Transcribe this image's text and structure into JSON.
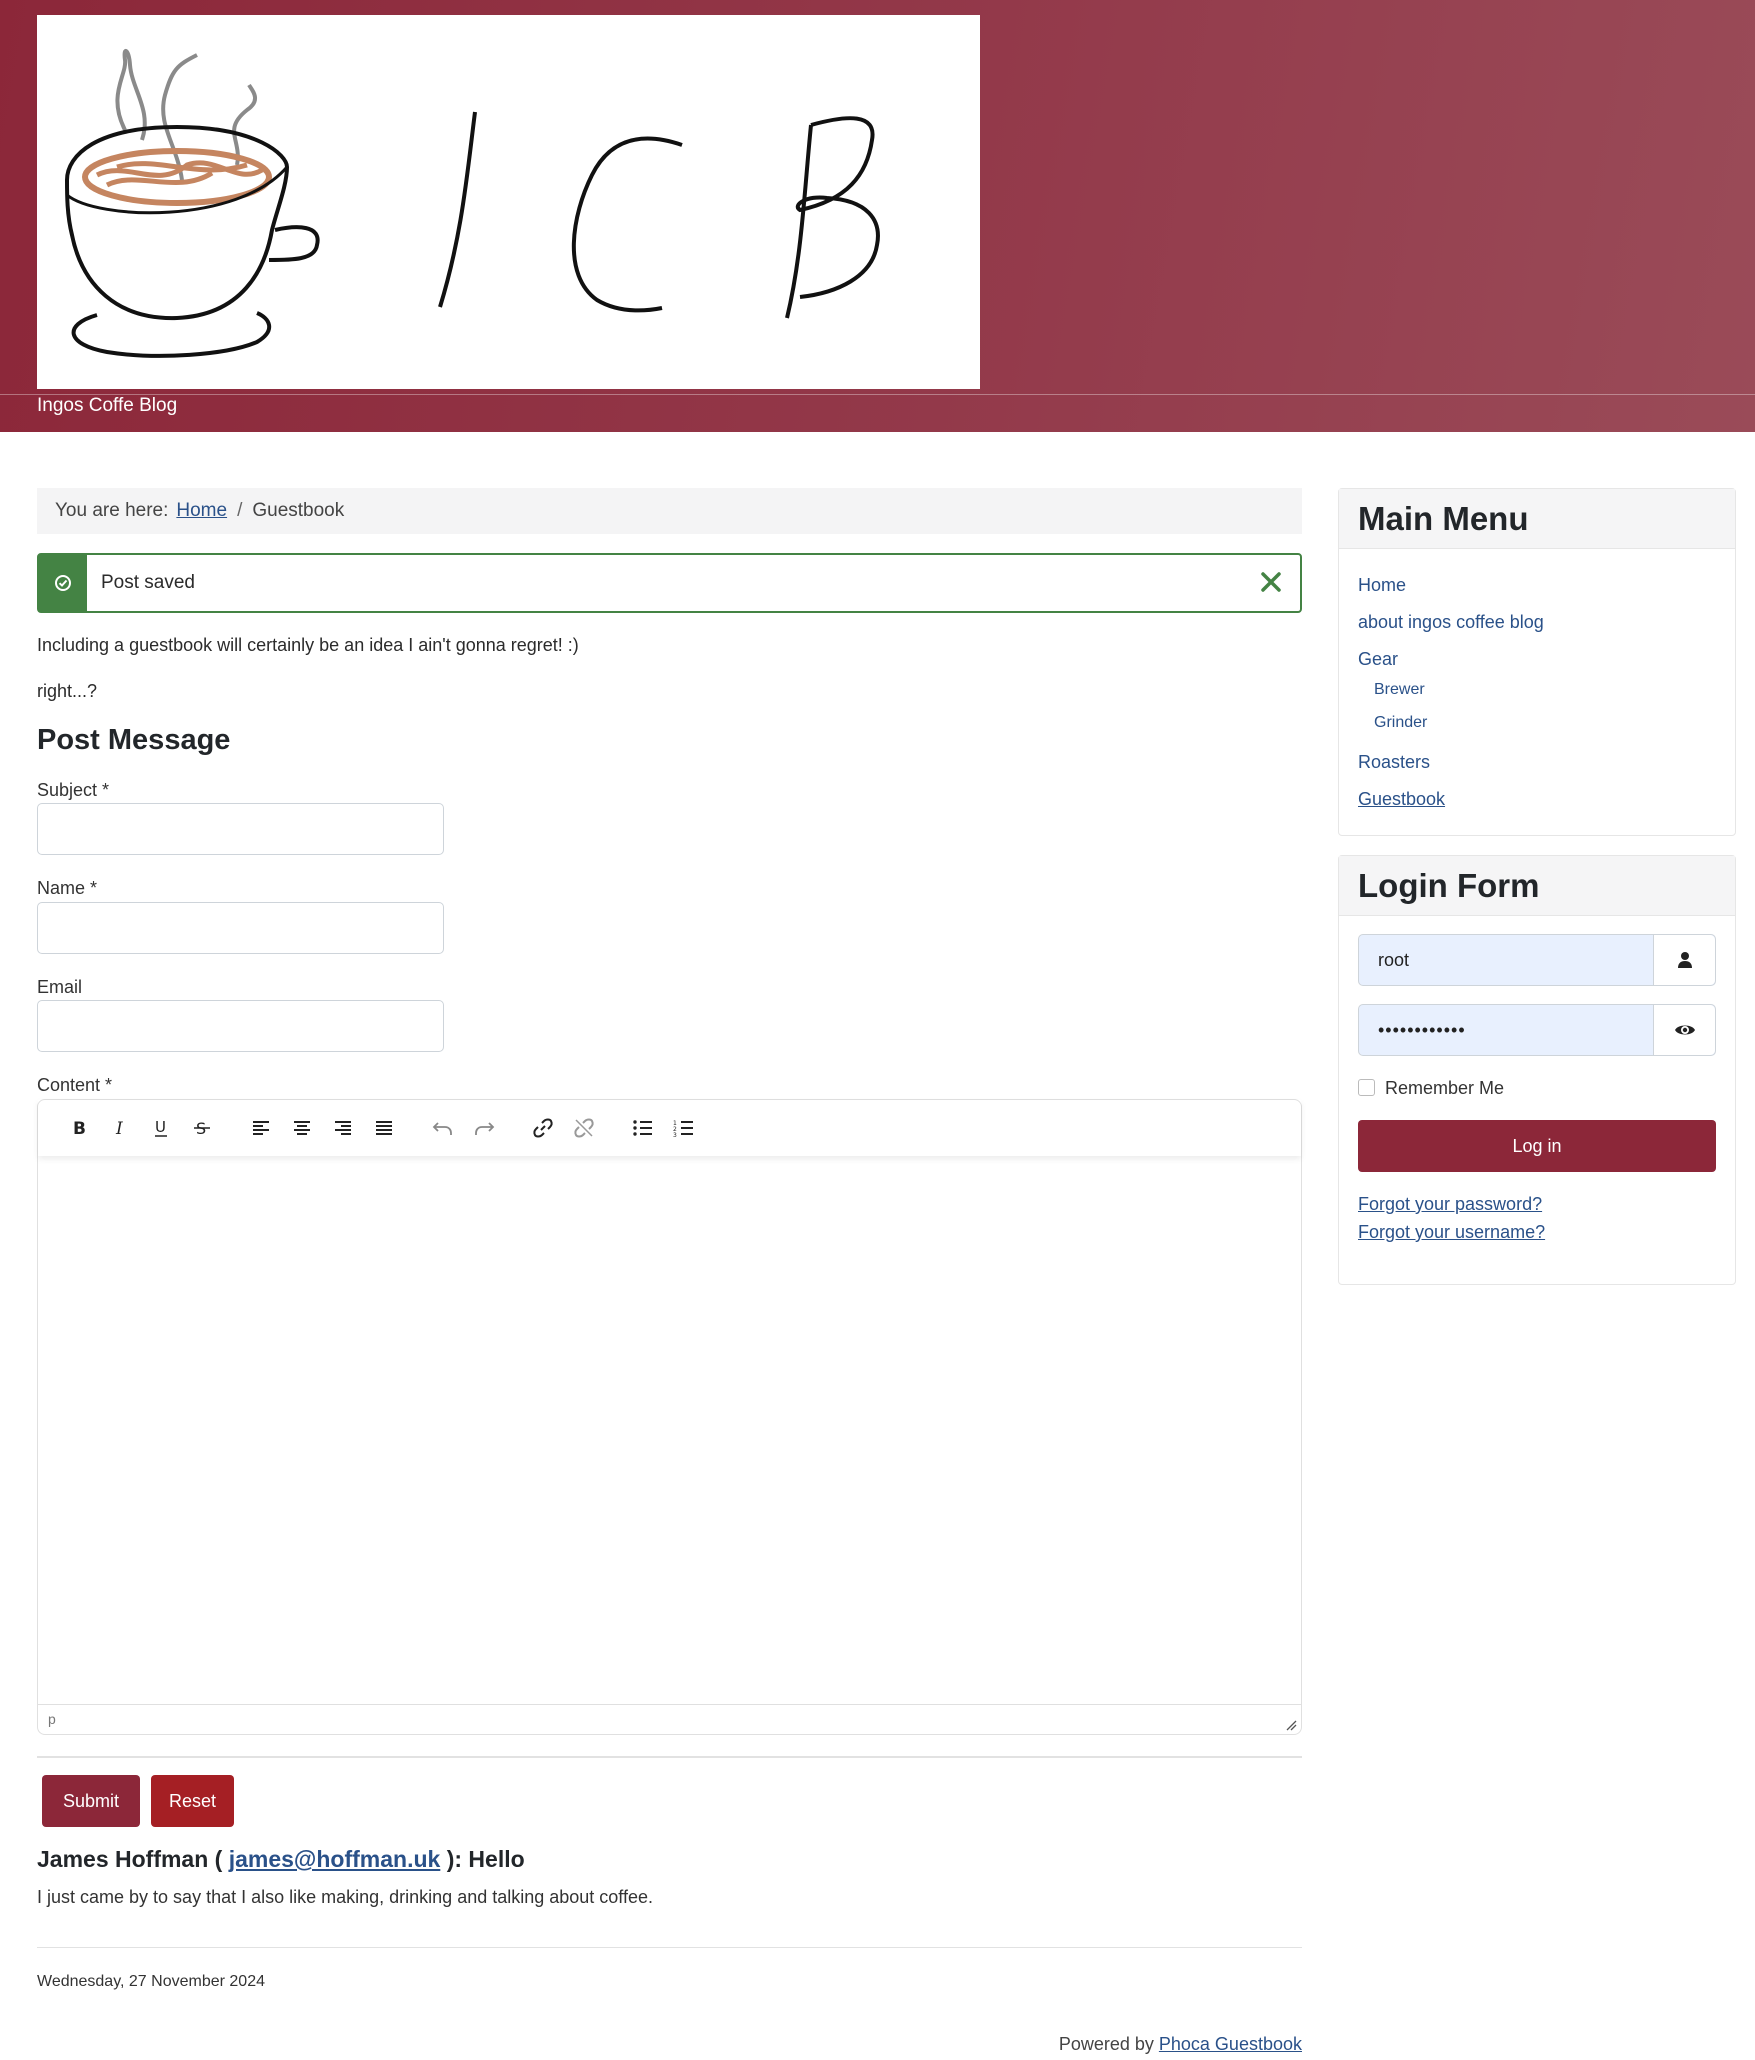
{
  "header": {
    "site_name": "Ingos Coffe Blog",
    "logo_text": "ICB"
  },
  "breadcrumb": {
    "prefix": "You are here:",
    "home": "Home",
    "separator": "/",
    "current": "Guestbook"
  },
  "alert": {
    "message": "Post saved",
    "icon": "check-circle-icon",
    "close_icon": "close-icon"
  },
  "intro": {
    "line1": "Including a guestbook will certainly be an idea I ain't gonna regret! :)",
    "line2": "right...?"
  },
  "form": {
    "title": "Post Message",
    "subject_label": "Subject *",
    "name_label": "Name *",
    "email_label": "Email",
    "content_label": "Content *",
    "status_path": "p",
    "submit_label": "Submit",
    "reset_label": "Reset",
    "toolbar": [
      "bold-icon",
      "italic-icon",
      "underline-icon",
      "strikethrough-icon",
      "align-left-icon",
      "align-center-icon",
      "align-right-icon",
      "align-justify-icon",
      "undo-icon",
      "redo-icon",
      "link-icon",
      "unlink-icon",
      "bullet-list-icon",
      "numbered-list-icon"
    ]
  },
  "entry": {
    "author": "James Hoffman (",
    "email": "james@hoffman.uk",
    "subject_suffix": "): Hello",
    "body": "I just came by to say that I also like making, drinking and talking about coffee.",
    "date": "Wednesday, 27 November 2024"
  },
  "footer": {
    "powered_prefix": "Powered by",
    "powered_link": "Phoca Guestbook"
  },
  "main_menu": {
    "title": "Main Menu",
    "items": {
      "home": "Home",
      "about": "about ingos coffee blog",
      "gear": "Gear",
      "brewer": "Brewer",
      "grinder": "Grinder",
      "roasters": "Roasters",
      "guestbook": "Guestbook"
    }
  },
  "login": {
    "title": "Login Form",
    "username": "root",
    "password_mask": "••••••••••••",
    "remember_label": "Remember Me",
    "login_button": "Log in",
    "forgot_password": "Forgot your password?",
    "forgot_username": "Forgot your username?"
  },
  "colors": {
    "brand": "#8c2739",
    "success": "#448344",
    "link": "#2a5189",
    "reset_button": "#a51f24"
  }
}
